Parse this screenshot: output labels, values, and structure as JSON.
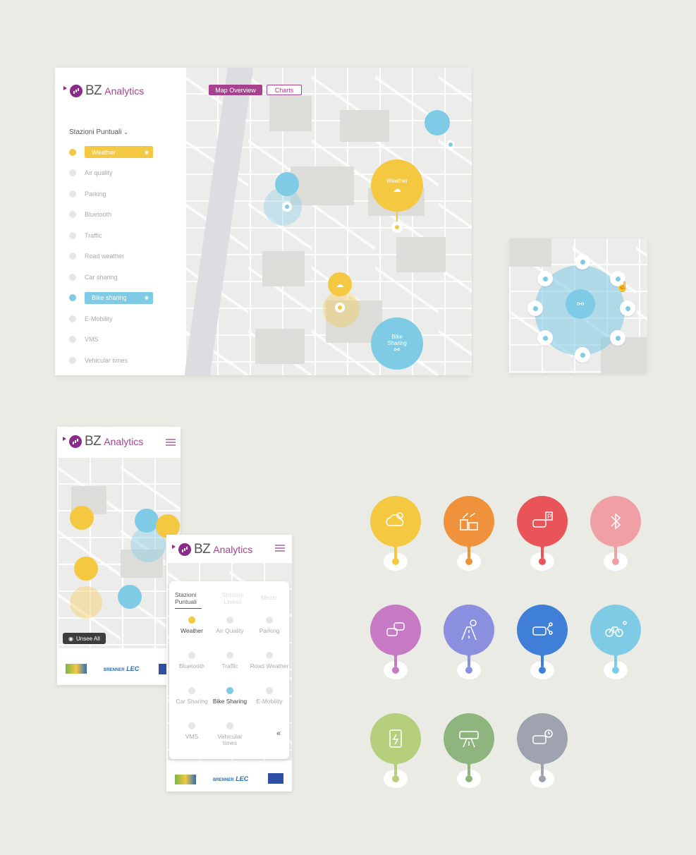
{
  "brand": {
    "bz": "BZ",
    "analytics": "Analytics"
  },
  "desktop": {
    "tabs": [
      {
        "label": "Map Overview"
      },
      {
        "label": "Charts"
      }
    ],
    "section_title": "Stazioni Puntuali",
    "categories": [
      {
        "label": "Weather",
        "active": true,
        "color": "#f5c842"
      },
      {
        "label": "Air quality"
      },
      {
        "label": "Parking"
      },
      {
        "label": "Bluetooth"
      },
      {
        "label": "Traffic"
      },
      {
        "label": "Road weather"
      },
      {
        "label": "Car sharing"
      },
      {
        "label": "Bike sharing",
        "active": true,
        "color": "#7fcbe6"
      },
      {
        "label": "E-Mobility"
      },
      {
        "label": "VMS"
      },
      {
        "label": "Vehicular times"
      }
    ],
    "markers": {
      "weather_large": "Weather",
      "bike_large_1": "Bike",
      "bike_large_2": "Sharing"
    }
  },
  "mobile1": {
    "unsee_all": "Unsee All",
    "footer": {
      "brenner": "BRENNER",
      "lec": "LEC"
    }
  },
  "mobile2": {
    "tabs": [
      {
        "label": "Stazioni Puntuali"
      },
      {
        "label": "Stazioni Lineari"
      },
      {
        "label": "Mezzi"
      }
    ],
    "grid": [
      {
        "label": "Weather",
        "active": true,
        "color": "#f5c842"
      },
      {
        "label": "Air Quality"
      },
      {
        "label": "Parking"
      },
      {
        "label": "Bluetooth"
      },
      {
        "label": "Traffic"
      },
      {
        "label": "Road Weather"
      },
      {
        "label": "Car Sharing"
      },
      {
        "label": "Bike Sharing",
        "active": true,
        "color": "#7fcbe6"
      },
      {
        "label": "E-Mobility"
      },
      {
        "label": "VMS"
      },
      {
        "label": "Vehicular times"
      }
    ],
    "collapse": "«",
    "footer": {
      "brenner": "BRENNER",
      "lec": "LEC"
    }
  },
  "icon_pins": [
    {
      "icon": "weather-icon",
      "color": "#f5c842"
    },
    {
      "icon": "air-quality-icon",
      "color": "#f0923c"
    },
    {
      "icon": "parking-icon",
      "color": "#e85458"
    },
    {
      "icon": "bluetooth-icon",
      "color": "#f0a0a5"
    },
    {
      "icon": "traffic-icon",
      "color": "#c77ac4"
    },
    {
      "icon": "road-weather-icon",
      "color": "#8b8fdf"
    },
    {
      "icon": "car-sharing-icon",
      "color": "#3f7fd8"
    },
    {
      "icon": "bike-sharing-icon",
      "color": "#7fcbe6"
    },
    {
      "icon": "e-mobility-icon",
      "color": "#b5cf7c"
    },
    {
      "icon": "vms-icon",
      "color": "#8fb57e"
    },
    {
      "icon": "vehicular-times-icon",
      "color": "#9ea3af"
    }
  ]
}
